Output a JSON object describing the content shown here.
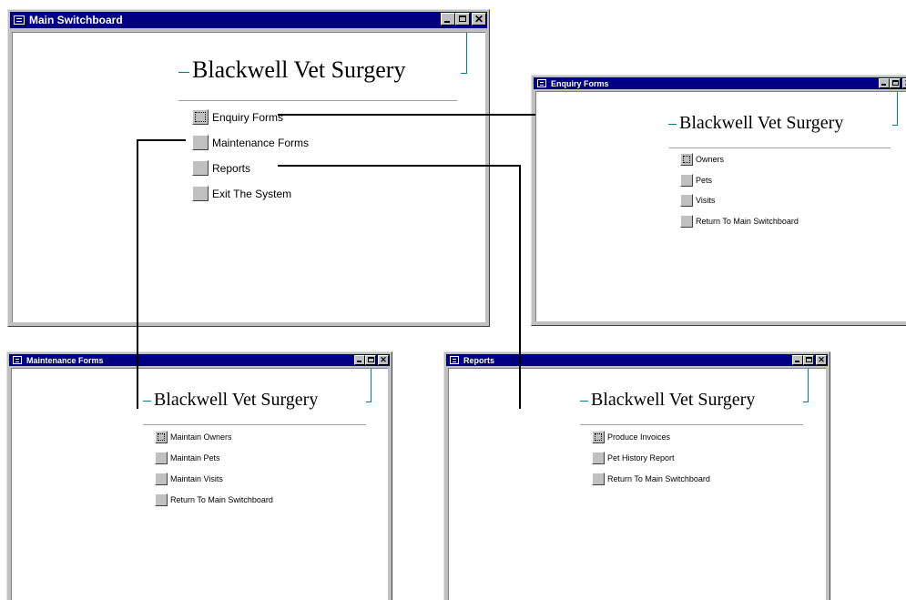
{
  "heading": "Blackwell Vet Surgery",
  "windows": {
    "main": {
      "title": "Main Switchboard",
      "items": [
        "Enquiry Forms",
        "Maintenance Forms",
        "Reports",
        "Exit The System"
      ]
    },
    "enquiry": {
      "title": "Enquiry Forms",
      "items": [
        "Owners",
        "Pets",
        "Visits",
        "Return To Main Switchboard"
      ]
    },
    "maintenance": {
      "title": "Maintenance Forms",
      "items": [
        "Maintain Owners",
        "Maintain Pets",
        "Maintain Visits",
        "Return To Main Switchboard"
      ]
    },
    "reports": {
      "title": "Reports",
      "items": [
        "Produce Invoices",
        "Pet History Report",
        "Return To Main Switchboard"
      ]
    }
  },
  "icons": {
    "window_icon": "switchboard-icon",
    "minimize": "minimize-icon",
    "maximize": "maximize-icon",
    "close": "close-icon"
  },
  "colors": {
    "titlebar": "#000080",
    "accent_line": "#008080",
    "window_face": "#c0c0c0",
    "connector": "#000000"
  }
}
